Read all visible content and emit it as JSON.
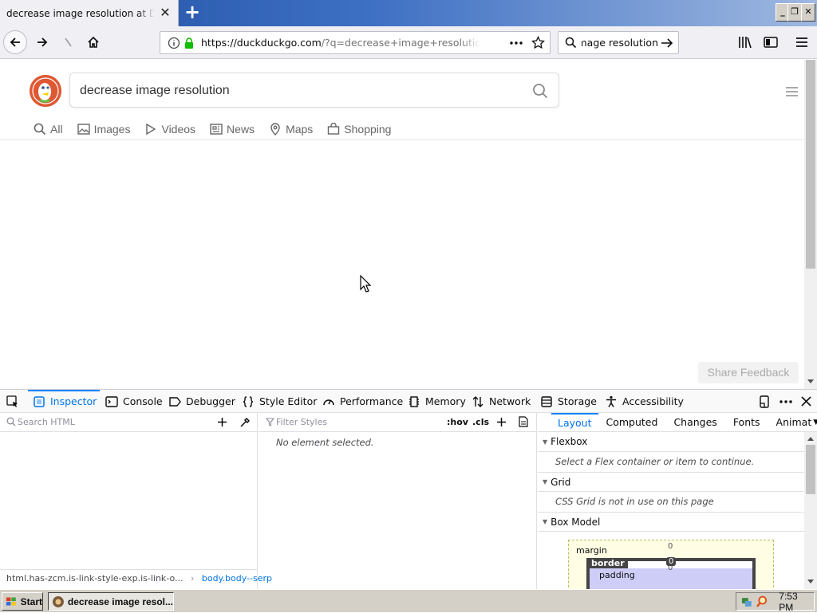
{
  "browser": {
    "tab_title": "decrease image resolution at DuckDuckGo",
    "url_host": "https://duckduckgo.com",
    "url_rest": "/?q=decrease+image+resolution&t=h_",
    "search_bar_text": "image resolution"
  },
  "page": {
    "query": "decrease image resolution",
    "tabs": [
      {
        "label": "All",
        "icon": "search-icon"
      },
      {
        "label": "Images",
        "icon": "image-icon"
      },
      {
        "label": "Videos",
        "icon": "play-icon"
      },
      {
        "label": "News",
        "icon": "newspaper-icon"
      },
      {
        "label": "Maps",
        "icon": "map-pin-icon"
      },
      {
        "label": "Shopping",
        "icon": "shopping-bag-icon"
      }
    ],
    "share_feedback": "Share Feedback"
  },
  "devtools": {
    "tabs": [
      {
        "label": "Inspector"
      },
      {
        "label": "Console"
      },
      {
        "label": "Debugger"
      },
      {
        "label": "Style Editor"
      },
      {
        "label": "Performance"
      },
      {
        "label": "Memory"
      },
      {
        "label": "Network"
      },
      {
        "label": "Storage"
      },
      {
        "label": "Accessibility"
      }
    ],
    "search_html_placeholder": "Search HTML",
    "filter_styles_placeholder": "Filter Styles",
    "hov": ":hov",
    "cls": ".cls",
    "no_element": "No element selected.",
    "breadcrumb_1": "html.has-zcm.is-link-style-exp.is-link-o...",
    "breadcrumb_2": "body.body--serp",
    "side_tabs": [
      "Layout",
      "Computed",
      "Changes",
      "Fonts",
      "Animat"
    ],
    "flexbox_title": "Flexbox",
    "flexbox_msg": "Select a Flex container or item to continue.",
    "grid_title": "Grid",
    "grid_msg": "CSS Grid is not in use on this page",
    "boxmodel_title": "Box Model",
    "bm_margin": "margin",
    "bm_border": "border",
    "bm_padding": "padding",
    "bm_zero": "0"
  },
  "taskbar": {
    "start": "Start",
    "task": "decrease image resol...",
    "clock": "7:53 PM"
  },
  "colors": {
    "accent": "#0a84ff",
    "ddg_orange": "#de5833",
    "secure_green": "#12bc00"
  }
}
